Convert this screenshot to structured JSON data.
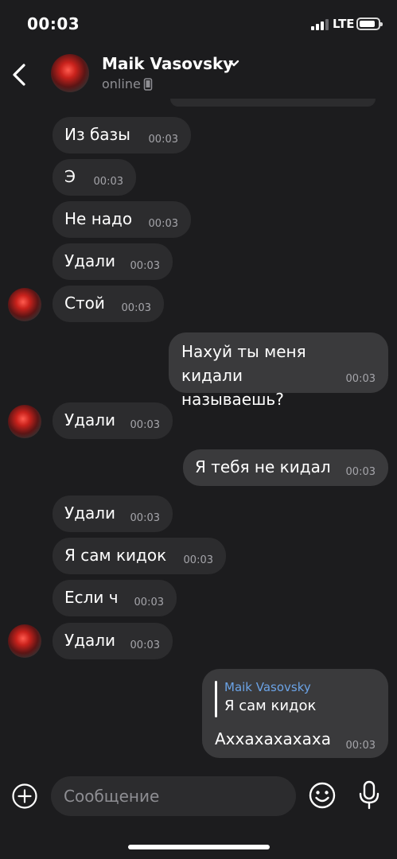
{
  "status_bar": {
    "time": "00:03",
    "network": "LTE",
    "signal_bars_active": 3,
    "signal_bars_total": 4,
    "battery_level": 0.85
  },
  "header": {
    "contact_name": "Maik Vasovsky",
    "contact_status": "online",
    "back_icon": "chevron-left-icon",
    "dropdown_icon": "chevron-down-icon",
    "device_icon": "phone-icon"
  },
  "messages": [
    {
      "direction": "in",
      "text": "Из базы",
      "time": "00:03",
      "show_avatar": false
    },
    {
      "direction": "in",
      "text": "Э",
      "time": "00:03",
      "show_avatar": false
    },
    {
      "direction": "in",
      "text": "Не надо",
      "time": "00:03",
      "show_avatar": false
    },
    {
      "direction": "in",
      "text": "Удали",
      "time": "00:03",
      "show_avatar": false
    },
    {
      "direction": "in",
      "text": "Стой",
      "time": "00:03",
      "show_avatar": true
    },
    {
      "direction": "out",
      "text": "Нахуй ты меня кидали называешь?",
      "time": "00:03"
    },
    {
      "direction": "in",
      "text": "Удали",
      "time": "00:03",
      "show_avatar": true
    },
    {
      "direction": "out",
      "text": "Я тебя не кидал",
      "time": "00:03"
    },
    {
      "direction": "in",
      "text": "Удали",
      "time": "00:03",
      "show_avatar": false
    },
    {
      "direction": "in",
      "text": "Я сам кидок",
      "time": "00:03",
      "show_avatar": false
    },
    {
      "direction": "in",
      "text": "Если ч",
      "time": "00:03",
      "show_avatar": false
    },
    {
      "direction": "in",
      "text": "Удали",
      "time": "00:03",
      "show_avatar": true
    },
    {
      "direction": "out",
      "text": "Аххахахахаха",
      "time": "00:03",
      "reply_to": {
        "name": "Maik Vasovsky",
        "text": "Я сам кидок"
      }
    }
  ],
  "input_bar": {
    "placeholder": "Сообщение",
    "attach_icon": "plus-circle-icon",
    "emoji_icon": "smiley-icon",
    "mic_icon": "microphone-icon"
  },
  "colors": {
    "background": "#1c1c1e",
    "incoming_bubble": "#2c2c2e",
    "outgoing_bubble": "#3a3a3c",
    "reply_name": "#6ba3e6",
    "timestamp": "#a5a5aa"
  }
}
